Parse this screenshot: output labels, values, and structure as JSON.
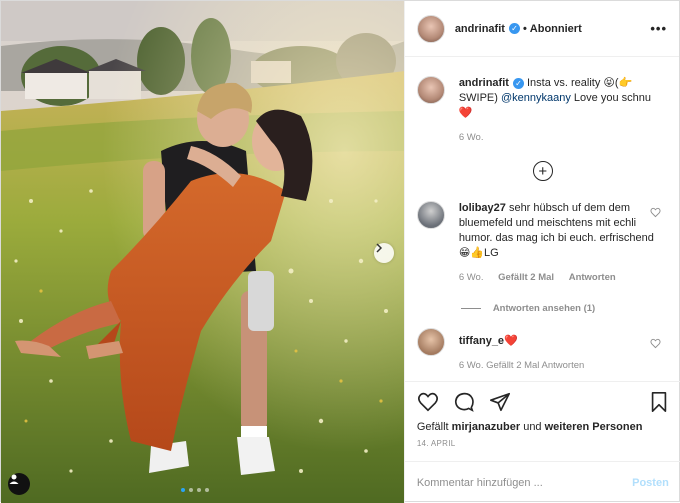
{
  "post": {
    "author": "andrinafit",
    "follow_state": "Abonniert",
    "separator": "•",
    "caption": {
      "username": "andrinafit",
      "text_before": " Insta vs. reality 😝(👉SWIPE) ",
      "mention": "@kennykaany",
      "text_after": " Love you schnu❤️",
      "time": "6 Wo."
    },
    "comments": [
      {
        "username": "lolibay27",
        "text": " sehr hübsch uf dem dem bluemefeld und meischtens mit echli humor. das mag ich bi euch. erfrischend😁👍LG",
        "time": "6 Wo.",
        "likes": "Gefällt 2 Mal",
        "reply": "Antworten",
        "view_replies": "Antworten ansehen (1)"
      },
      {
        "username": "tiffany_e",
        "text": "❤️",
        "meta_partial": "6 Wo.   Gefällt 2 Mal   Antworten"
      }
    ],
    "likes": {
      "prefix": "Gefällt ",
      "user": "mirjanazuber",
      "middle": " und ",
      "others": "weiteren Personen"
    },
    "date": "14. APRIL",
    "composer": {
      "placeholder": "Kommentar hinzufügen ...",
      "submit": "Posten"
    }
  },
  "carousel": {
    "slide_index": 1,
    "slide_count": 4,
    "accent": "#2aa5f5"
  },
  "colors": {
    "verified": "#3897f0",
    "link": "#00376b",
    "muted": "#8e8e8e",
    "post_disabled": "#b2dffc"
  },
  "icons": [
    "verified-icon",
    "more-icon",
    "plus-circle-icon",
    "heart-icon",
    "comment-icon",
    "share-icon",
    "bookmark-icon",
    "chevron-right-icon",
    "user-tag-icon"
  ]
}
